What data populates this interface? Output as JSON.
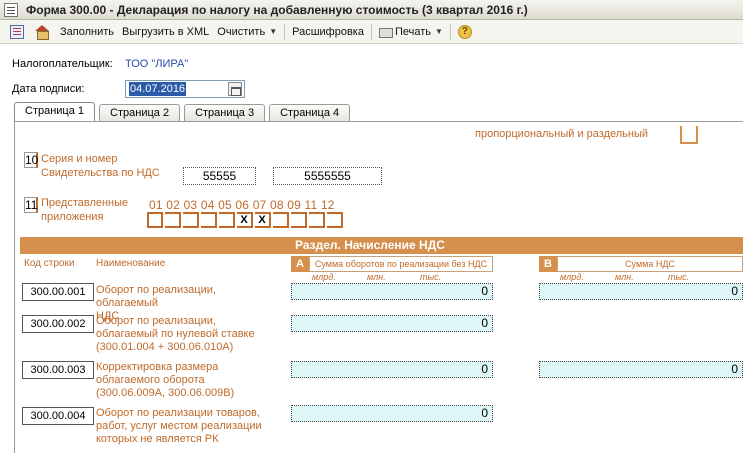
{
  "window": {
    "title": "Форма 300.00 - Декларация по налогу на добавленную стоимость (3 квартал 2016 г.)"
  },
  "toolbar": {
    "fill": "Заполнить",
    "export_xml": "Выгрузить в XML",
    "clear": "Очистить",
    "decode": "Расшифровка",
    "print": "Печать"
  },
  "taxpayer": {
    "label": "Налогоплательщик:",
    "value": "ТОО \"ЛИРА\""
  },
  "sign_date": {
    "label": "Дата подписи:",
    "value": "04.07.2016"
  },
  "tabs": [
    "Страница 1",
    "Страница 2",
    "Страница 3",
    "Страница 4"
  ],
  "form": {
    "prop_label": "пропорциональный и раздельный",
    "field10": {
      "num": "10",
      "label_line1": "Серия и номер",
      "label_line2": "Свидетельства по НДС",
      "series": "55555",
      "number": "5555555"
    },
    "field11": {
      "num": "11",
      "label_line1": "Представленные",
      "label_line2": "приложения",
      "appendix_labels": "01 02 03 04 05 06 07 08 09 11 12",
      "checks": [
        "",
        "",
        "",
        "",
        "",
        "X",
        "X",
        "",
        "",
        "",
        ""
      ]
    },
    "section_title": "Раздел. Начисление НДС",
    "col_code": "Код строки",
    "col_name": "Наименование",
    "col_a": {
      "letter": "A",
      "caption": "Сумма оборотов по реализации без НДС"
    },
    "col_b": {
      "letter": "B",
      "caption": "Сумма НДС"
    },
    "units": {
      "bn": "млрд.",
      "mn": "млн.",
      "th": "тыс."
    },
    "rows": [
      {
        "code": "300.00.001",
        "name_l1": "Оборот по реализации, облагаемый",
        "name_l2": "НДС",
        "name_l3": "",
        "name_l4": "",
        "a": "0",
        "b": "0"
      },
      {
        "code": "300.00.002",
        "name_l1": "Оборот по реализации,",
        "name_l2": "облагаемый по нулевой ставке",
        "name_l3": "(300.01.004 + 300.06.010А)",
        "name_l4": "",
        "a": "0",
        "b": ""
      },
      {
        "code": "300.00.003",
        "name_l1": "Корректировка размера",
        "name_l2": "облагаемого оборота",
        "name_l3": "(300.06.009А, 300.06.009В)",
        "name_l4": "",
        "a": "0",
        "b": "0"
      },
      {
        "code": "300.00.004",
        "name_l1": "Оборот по реализации товаров,",
        "name_l2": "работ, услуг местом реализации",
        "name_l3": "которых не является РК",
        "name_l4": "",
        "a": "0",
        "b": ""
      }
    ]
  }
}
